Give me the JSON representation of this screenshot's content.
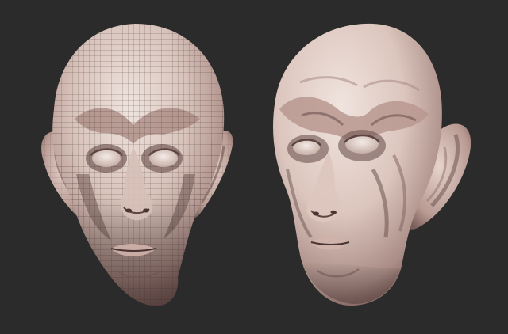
{
  "scene": {
    "background_color": "#2b2b2b",
    "skin_light": "#e9dcd5",
    "skin_mid": "#cdb5ad",
    "skin_shadow": "#8d6f69",
    "skin_deep": "#5d4440",
    "wire_color": "#3a2a28",
    "left_model": "wireframe-head-sculpt",
    "right_model": "smooth-head-sculpt"
  }
}
